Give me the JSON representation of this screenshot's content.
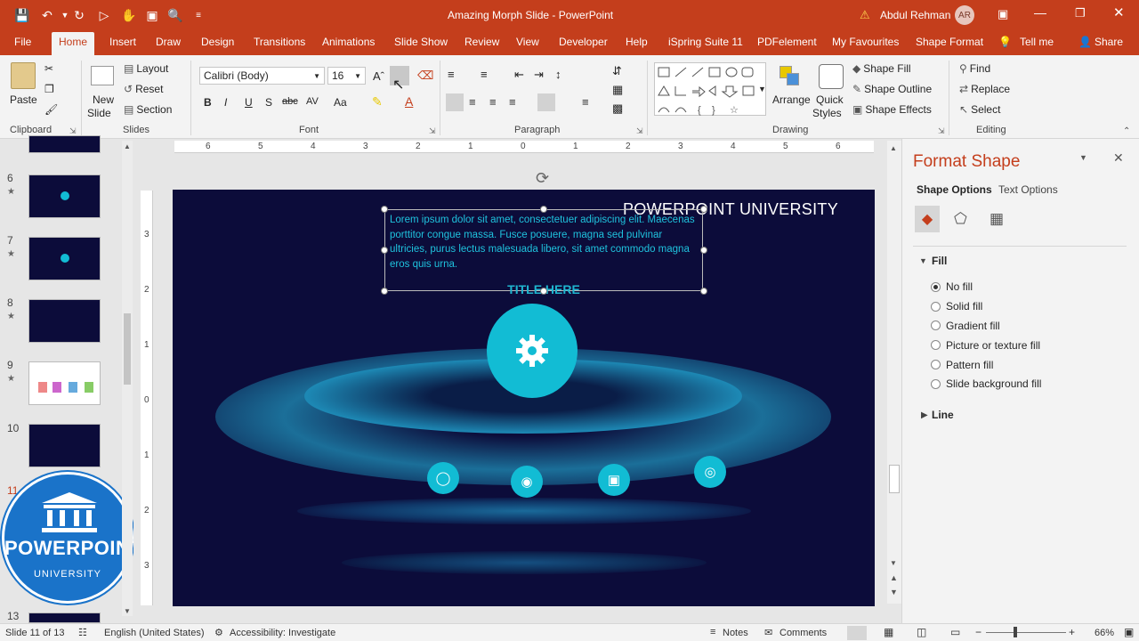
{
  "window": {
    "title": "Amazing Morph Slide  -  PowerPoint",
    "user": "Abdul Rehman",
    "user_initials": "AR"
  },
  "ribbon_tabs": [
    "File",
    "Home",
    "Insert",
    "Draw",
    "Design",
    "Transitions",
    "Animations",
    "Slide Show",
    "Review",
    "View",
    "Developer",
    "Help",
    "iSpring Suite 11",
    "PDFelement",
    "My Favourites",
    "Shape Format"
  ],
  "tell_me": "Tell me",
  "share": "Share",
  "clipboard": {
    "paste": "Paste",
    "label": "Clipboard"
  },
  "slides_group": {
    "new_slide": "New",
    "new_slide2": "Slide",
    "layout": "Layout",
    "reset": "Reset",
    "section": "Section",
    "label": "Slides"
  },
  "font_group": {
    "font": "Calibri (Body)",
    "size": "16",
    "label": "Font",
    "bold": "B",
    "italic": "I",
    "underline": "U",
    "shadow": "S",
    "strike": "abc",
    "spacing": "AV",
    "case": "Aa"
  },
  "paragraph_group": {
    "label": "Paragraph"
  },
  "drawing_group": {
    "label": "Drawing",
    "arrange": "Arrange",
    "quick_styles": "Quick",
    "quick_styles2": "Styles",
    "shape_fill": "Shape Fill",
    "shape_outline": "Shape Outline",
    "shape_effects": "Shape Effects"
  },
  "editing_group": {
    "label": "Editing",
    "find": "Find",
    "replace": "Replace",
    "select": "Select"
  },
  "thumbnails": [
    {
      "num": "6",
      "star": "★"
    },
    {
      "num": "7",
      "star": "★"
    },
    {
      "num": "8",
      "star": "★"
    },
    {
      "num": "9",
      "star": "★"
    },
    {
      "num": "10",
      "star": ""
    },
    {
      "num": "11",
      "star": ""
    },
    {
      "num": "13",
      "star": ""
    }
  ],
  "ruler_h": [
    "6",
    "5",
    "4",
    "3",
    "2",
    "1",
    "0",
    "1",
    "2",
    "3",
    "4",
    "5",
    "6"
  ],
  "ruler_v": [
    "3",
    "2",
    "1",
    "0",
    "1",
    "2",
    "3"
  ],
  "slide": {
    "brand": "POWERPOINT UNIVERSITY",
    "body": "Lorem ipsum dolor sit amet, consectetuer adipiscing elit. Maecenas porttitor congue massa. Fusce posuere, magna sed pulvinar ultricies, purus lectus malesuada libero, sit amet commodo magna eros quis urna.",
    "title": "TITLE HERE",
    "icons": [
      "lightbulb-icon",
      "head-icon",
      "presentation-icon",
      "target-icon"
    ]
  },
  "logo": {
    "line1": "POWERPOINT",
    "line2": "UNIVERSITY"
  },
  "format_pane": {
    "title": "Format Shape",
    "tab_shape": "Shape Options",
    "tab_text": "Text Options",
    "fill_header": "Fill",
    "fill_options": [
      "No fill",
      "Solid fill",
      "Gradient fill",
      "Picture or texture fill",
      "Pattern fill",
      "Slide background fill"
    ],
    "selected": "No fill",
    "line_header": "Line"
  },
  "status": {
    "slide": "Slide 11 of 13",
    "language": "English (United States)",
    "accessibility": "Accessibility: Investigate",
    "notes": "Notes",
    "comments": "Comments",
    "zoom": "66%"
  },
  "colors": {
    "accent": "#c43e1c",
    "slide_bg": "#0c0c3a",
    "cyan": "#12bcd4"
  }
}
